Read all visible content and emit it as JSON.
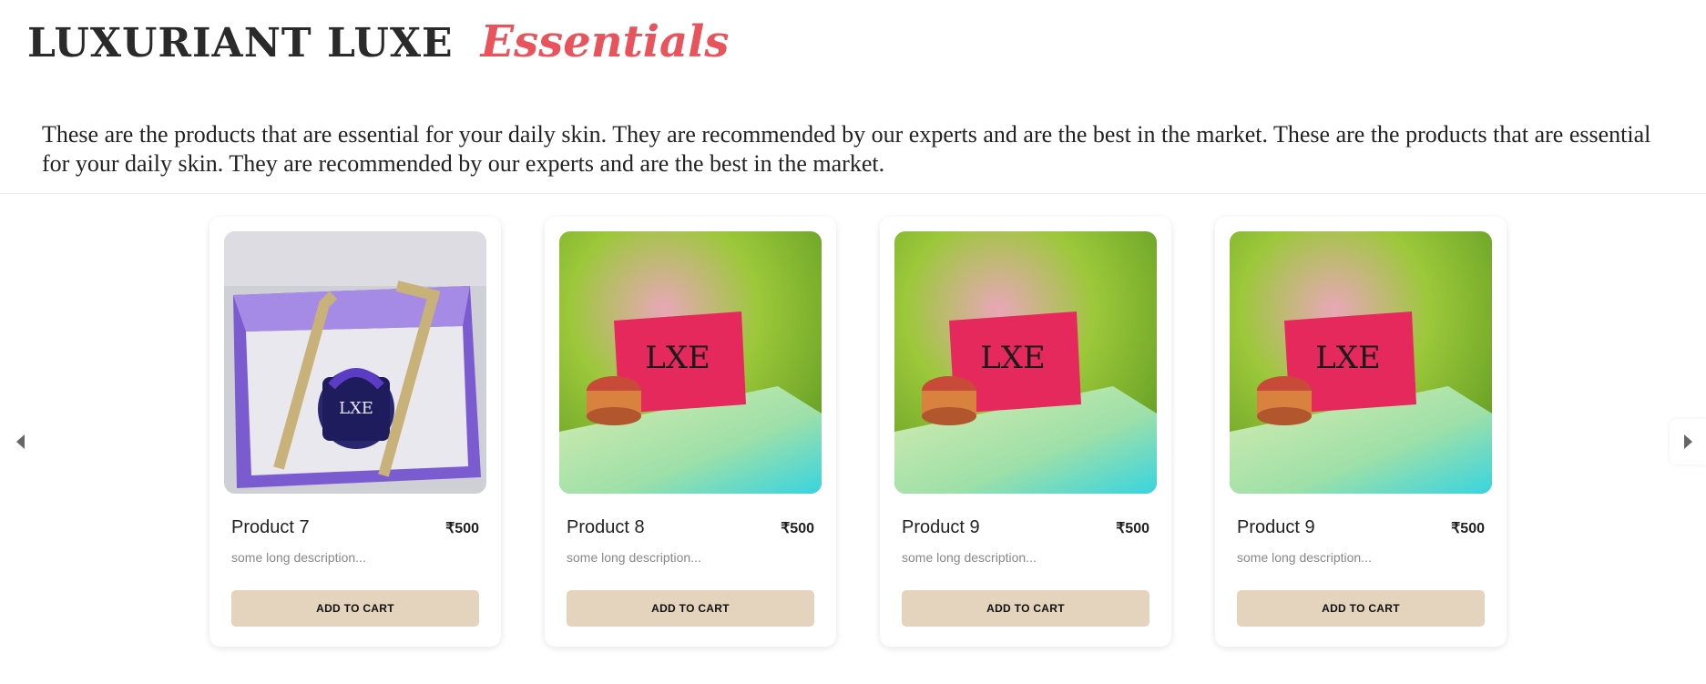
{
  "header": {
    "brand": "LUXURIANT LUXE",
    "accent": "Essentials"
  },
  "intro": "These are the products that are essential for your daily skin. They are recommended by our experts and are the best in the market. These are the products that are essential for your daily skin. They are recommended by our experts and are the best in the market.",
  "carousel": {
    "prev_icon": "triangle-left-icon",
    "next_icon": "triangle-right-icon",
    "products": [
      {
        "name": "Product 7",
        "price": "₹500",
        "description": "some long description...",
        "button": "ADD TO CART",
        "image": "purple-gift-box-jar-photo"
      },
      {
        "name": "Product 8",
        "price": "₹500",
        "description": "some long description...",
        "button": "ADD TO CART",
        "image": "pink-luxe-box-green-backdrop-photo"
      },
      {
        "name": "Product 9",
        "price": "₹500",
        "description": "some long description...",
        "button": "ADD TO CART",
        "image": "pink-luxe-box-green-backdrop-photo"
      },
      {
        "name": "Product 9",
        "price": "₹500",
        "description": "some long description...",
        "button": "ADD TO CART",
        "image": "pink-luxe-box-green-backdrop-photo"
      }
    ]
  },
  "colors": {
    "accent": "#e8535c",
    "button_bg": "#e4d3bd",
    "text": "#222222",
    "muted": "#888888"
  }
}
